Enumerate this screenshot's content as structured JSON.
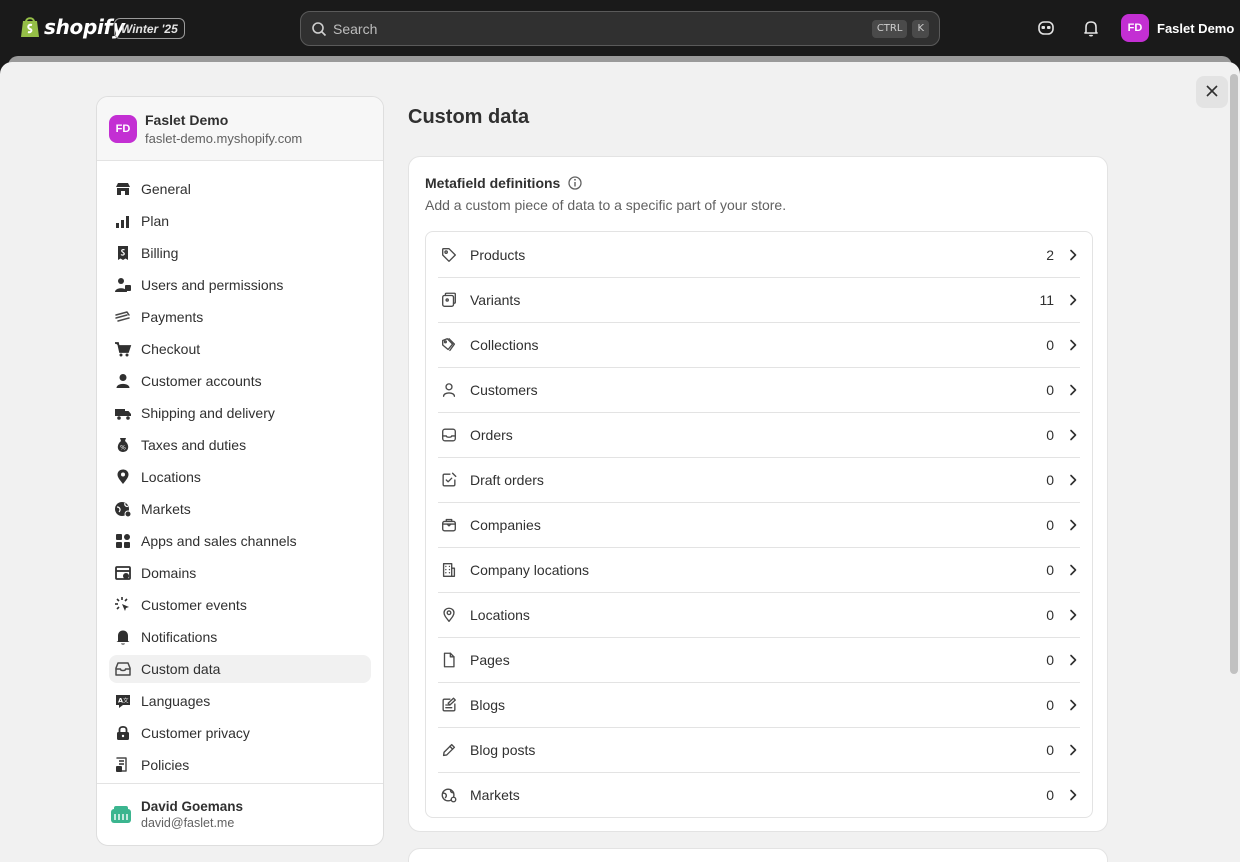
{
  "topbar": {
    "brand": "shopify",
    "edition_badge": "Winter '25",
    "search_placeholder": "Search",
    "shortcut_keys": [
      "CTRL",
      "K"
    ],
    "user_initials": "FD",
    "user_name": "Faslet Demo"
  },
  "store": {
    "initials": "FD",
    "name": "Faslet Demo",
    "url": "faslet-demo.myshopify.com"
  },
  "nav": [
    {
      "label": "General",
      "icon": "store-icon"
    },
    {
      "label": "Plan",
      "icon": "plan-icon"
    },
    {
      "label": "Billing",
      "icon": "billing-icon"
    },
    {
      "label": "Users and permissions",
      "icon": "users-icon"
    },
    {
      "label": "Payments",
      "icon": "payments-icon"
    },
    {
      "label": "Checkout",
      "icon": "cart-icon"
    },
    {
      "label": "Customer accounts",
      "icon": "person-icon"
    },
    {
      "label": "Shipping and delivery",
      "icon": "truck-icon"
    },
    {
      "label": "Taxes and duties",
      "icon": "tax-icon"
    },
    {
      "label": "Locations",
      "icon": "location-pin-icon"
    },
    {
      "label": "Markets",
      "icon": "globe-icon"
    },
    {
      "label": "Apps and sales channels",
      "icon": "apps-icon"
    },
    {
      "label": "Domains",
      "icon": "domains-icon"
    },
    {
      "label": "Customer events",
      "icon": "cursor-icon"
    },
    {
      "label": "Notifications",
      "icon": "bell-icon"
    },
    {
      "label": "Custom data",
      "icon": "custom-data-icon",
      "active": true
    },
    {
      "label": "Languages",
      "icon": "languages-icon"
    },
    {
      "label": "Customer privacy",
      "icon": "lock-icon"
    },
    {
      "label": "Policies",
      "icon": "policies-icon"
    }
  ],
  "account": {
    "name": "David Goemans",
    "email": "david@faslet.me"
  },
  "main": {
    "title": "Custom data",
    "metafields": {
      "title": "Metafield definitions",
      "subtitle": "Add a custom piece of data to a specific part of your store.",
      "rows": [
        {
          "label": "Products",
          "count": "2",
          "icon": "tag-icon"
        },
        {
          "label": "Variants",
          "count": "11",
          "icon": "variants-icon"
        },
        {
          "label": "Collections",
          "count": "0",
          "icon": "collections-icon"
        },
        {
          "label": "Customers",
          "count": "0",
          "icon": "person-icon"
        },
        {
          "label": "Orders",
          "count": "0",
          "icon": "inbox-icon"
        },
        {
          "label": "Draft orders",
          "count": "0",
          "icon": "draft-order-icon"
        },
        {
          "label": "Companies",
          "count": "0",
          "icon": "briefcase-icon"
        },
        {
          "label": "Company locations",
          "count": "0",
          "icon": "building-icon"
        },
        {
          "label": "Locations",
          "count": "0",
          "icon": "location-pin-icon"
        },
        {
          "label": "Pages",
          "count": "0",
          "icon": "page-icon"
        },
        {
          "label": "Blogs",
          "count": "0",
          "icon": "blog-icon"
        },
        {
          "label": "Blog posts",
          "count": "0",
          "icon": "pencil-icon"
        },
        {
          "label": "Markets",
          "count": "0",
          "icon": "globe-icon"
        }
      ]
    }
  },
  "colors": {
    "topbar_bg": "#1a1a1a",
    "surface_bg": "#f1f1f1",
    "avatar_bg": "#c32fd3",
    "text": "#303030",
    "text_muted": "#616161"
  }
}
